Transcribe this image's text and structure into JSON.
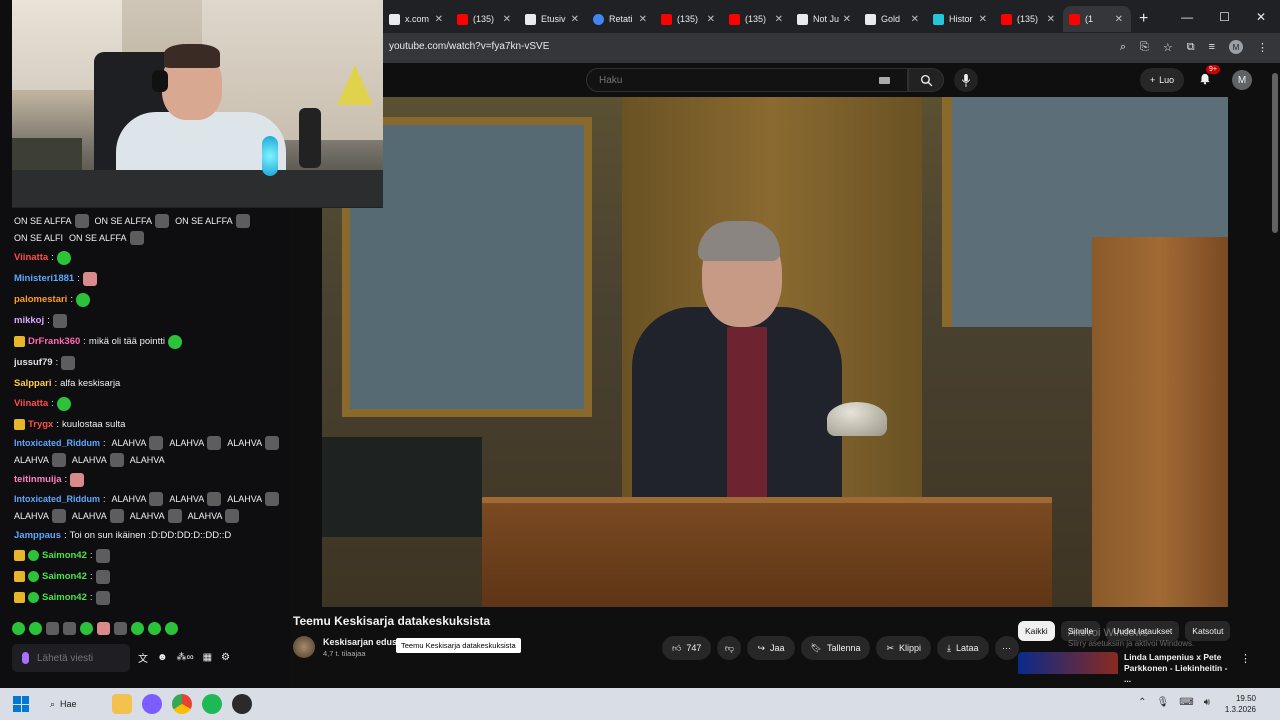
{
  "browser": {
    "tabs": [
      {
        "label": "x.com",
        "favicon": "x-logo-icon",
        "color": "#ffffff"
      },
      {
        "label": "(135)",
        "favicon": "youtube-icon",
        "color": "#ff0000"
      },
      {
        "label": "Etusiv",
        "favicon": "x-logo-icon",
        "color": "#ffffff"
      },
      {
        "label": "Retati",
        "favicon": "google-icon",
        "color": "#4285f4"
      },
      {
        "label": "(135)",
        "favicon": "youtube-icon",
        "color": "#ff0000"
      },
      {
        "label": "(135)",
        "favicon": "youtube-icon",
        "color": "#ff0000"
      },
      {
        "label": "Not Ju",
        "favicon": "x-logo-icon",
        "color": "#ffffff"
      },
      {
        "label": "Gold",
        "favicon": "wiki-icon",
        "color": "#ffffff"
      },
      {
        "label": "Histor",
        "favicon": "site-icon",
        "color": "#26c6da"
      },
      {
        "label": "(135)",
        "favicon": "youtube-icon",
        "color": "#ff0000"
      },
      {
        "label": "(1",
        "favicon": "youtube-icon",
        "color": "#ff0000"
      }
    ],
    "new_tab": "+",
    "close_glyph": "✕",
    "url": "youtube.com/watch?v=fya7kn-vSVE"
  },
  "youtube": {
    "search_placeholder": "Haku",
    "create_label": "Luo",
    "notification_count": "9+",
    "avatar_letter": "M",
    "video_title": "Teemu Keskisarja datakeskuksista",
    "channel_name": "Keskisarjan edus",
    "subscribers": "4,7 t. tilaajaa",
    "tooltip": "Teemu Keskisarja datakeskuksista",
    "likes": "747",
    "share": "Jaa",
    "save": "Tallenna",
    "clip": "Klippi",
    "download": "Lataa",
    "filters": [
      "Kaikki",
      "Sinulle",
      "Uudet lataukset",
      "Katsotut"
    ],
    "recommended_title": "Linda Lampenius x Pete Parkkonen - Liekinheitin - ...",
    "windows_watermark_1": "Aktivoi Windows",
    "windows_watermark_2": "Siirry asetuksiin ja aktivoi Windows."
  },
  "chat": {
    "spam_top": [
      "ON SE ALFFA",
      "ON SE ALFFA",
      "ON SE ALFFA",
      "ON SE ALFI",
      "ON SE ALFFA"
    ],
    "messages": [
      {
        "user": "Viinatta",
        "color": "#ff4d4d",
        "text": ""
      },
      {
        "user": "Ministeri1881",
        "color": "#5ca8ff",
        "text": ""
      },
      {
        "user": "palomestari",
        "color": "#ff9f1a",
        "text": ""
      },
      {
        "user": "mikkoj",
        "color": "#d9a8ff",
        "text": ""
      },
      {
        "user": "DrFrank360",
        "color": "#ff69b4",
        "text": "mikä oli tää pointti"
      },
      {
        "user": "jussuf79",
        "color": "#e0e0e0",
        "text": ""
      },
      {
        "user": "Salppari",
        "color": "#ffcf40",
        "text": "alfa keskisarja"
      },
      {
        "user": "Viinatta",
        "color": "#ff4d4d",
        "text": ""
      },
      {
        "user": "Trygx",
        "color": "#ff4d4d",
        "text": "kuulostaa sulta"
      }
    ],
    "alahva_user_1": "Intoxicated_Riddum",
    "alahva_word": "ALAHVA",
    "teitinmuija": "teitinmuija",
    "alahva_user_2": "Intoxicated_Riddum",
    "jamppaus_user": "Jamppaus",
    "jamppaus_text": "Toi on sun ikäinen :D:DD:DD:D::DD::D",
    "saimon": "Saimon42",
    "input_placeholder": "Lähetä viesti"
  },
  "taskbar": {
    "search_label": "Hae",
    "time": "19.50",
    "date": "1.3.2026"
  }
}
